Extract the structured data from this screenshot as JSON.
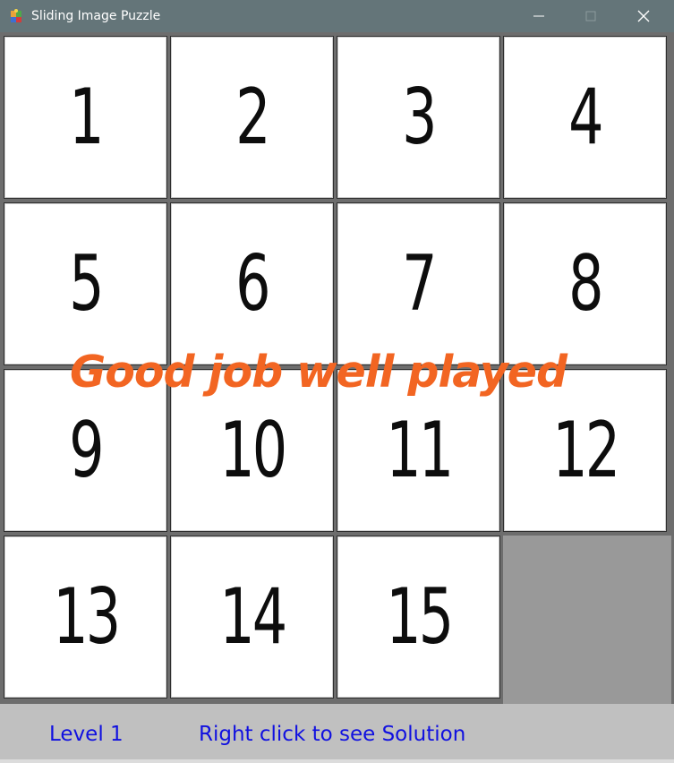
{
  "window": {
    "title": "Sliding Image Puzzle",
    "icon": "puzzle-app-icon",
    "buttons": [
      "minimize",
      "maximize",
      "close"
    ],
    "colors": {
      "titlebar": "#647579",
      "tile_bg": "#ffffff",
      "empty_tile": "#999999",
      "message": "#f26522",
      "status_text": "#1010e0",
      "statusbar": "#c0c0c0"
    }
  },
  "board": {
    "tiles": [
      "1",
      "2",
      "3",
      "4",
      "5",
      "6",
      "7",
      "8",
      "9",
      "10",
      "11",
      "12",
      "13",
      "14",
      "15"
    ],
    "empty_index": 15
  },
  "message": "Good job well played",
  "status": {
    "level": "Level 1",
    "hint": "Right click to see Solution"
  }
}
